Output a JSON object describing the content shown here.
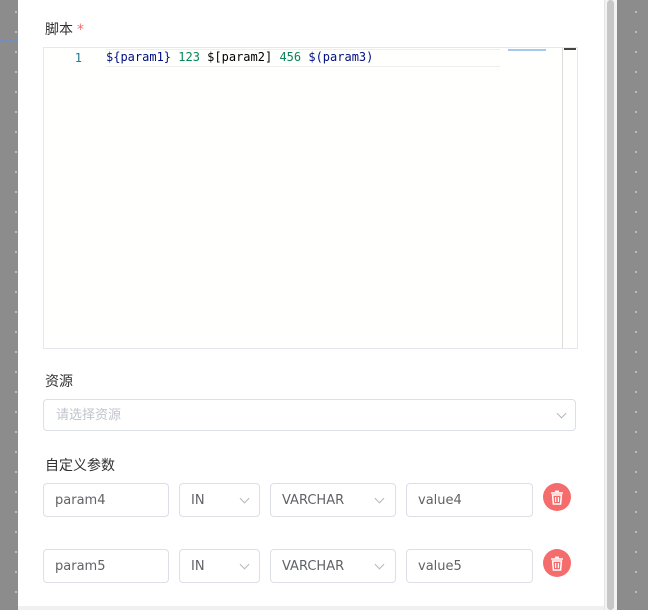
{
  "form": {
    "script_label": "脚本",
    "required_mark": "*",
    "resource_label": "资源",
    "custom_params_label": "自定义参数"
  },
  "editor": {
    "line_numbers": [
      "1"
    ],
    "tokens": [
      {
        "text": "${param1}",
        "kind": "var"
      },
      {
        "text": " ",
        "kind": "plain"
      },
      {
        "text": "123",
        "kind": "num"
      },
      {
        "text": " $[param2] ",
        "kind": "plain"
      },
      {
        "text": "456",
        "kind": "num"
      },
      {
        "text": " ",
        "kind": "plain"
      },
      {
        "text": "$(param3)",
        "kind": "var"
      }
    ]
  },
  "resource_select": {
    "placeholder": "请选择资源"
  },
  "params": [
    {
      "name": "param4",
      "direction": "IN",
      "type": "VARCHAR",
      "value": "value4"
    },
    {
      "name": "param5",
      "direction": "IN",
      "type": "VARCHAR",
      "value": "value5"
    }
  ],
  "colors": {
    "danger": "#f56c6c",
    "border": "#dcdfe6",
    "placeholder": "#c0c4cc"
  },
  "icons": {
    "delete": "trash-icon",
    "dropdown": "chevron-down-icon"
  }
}
